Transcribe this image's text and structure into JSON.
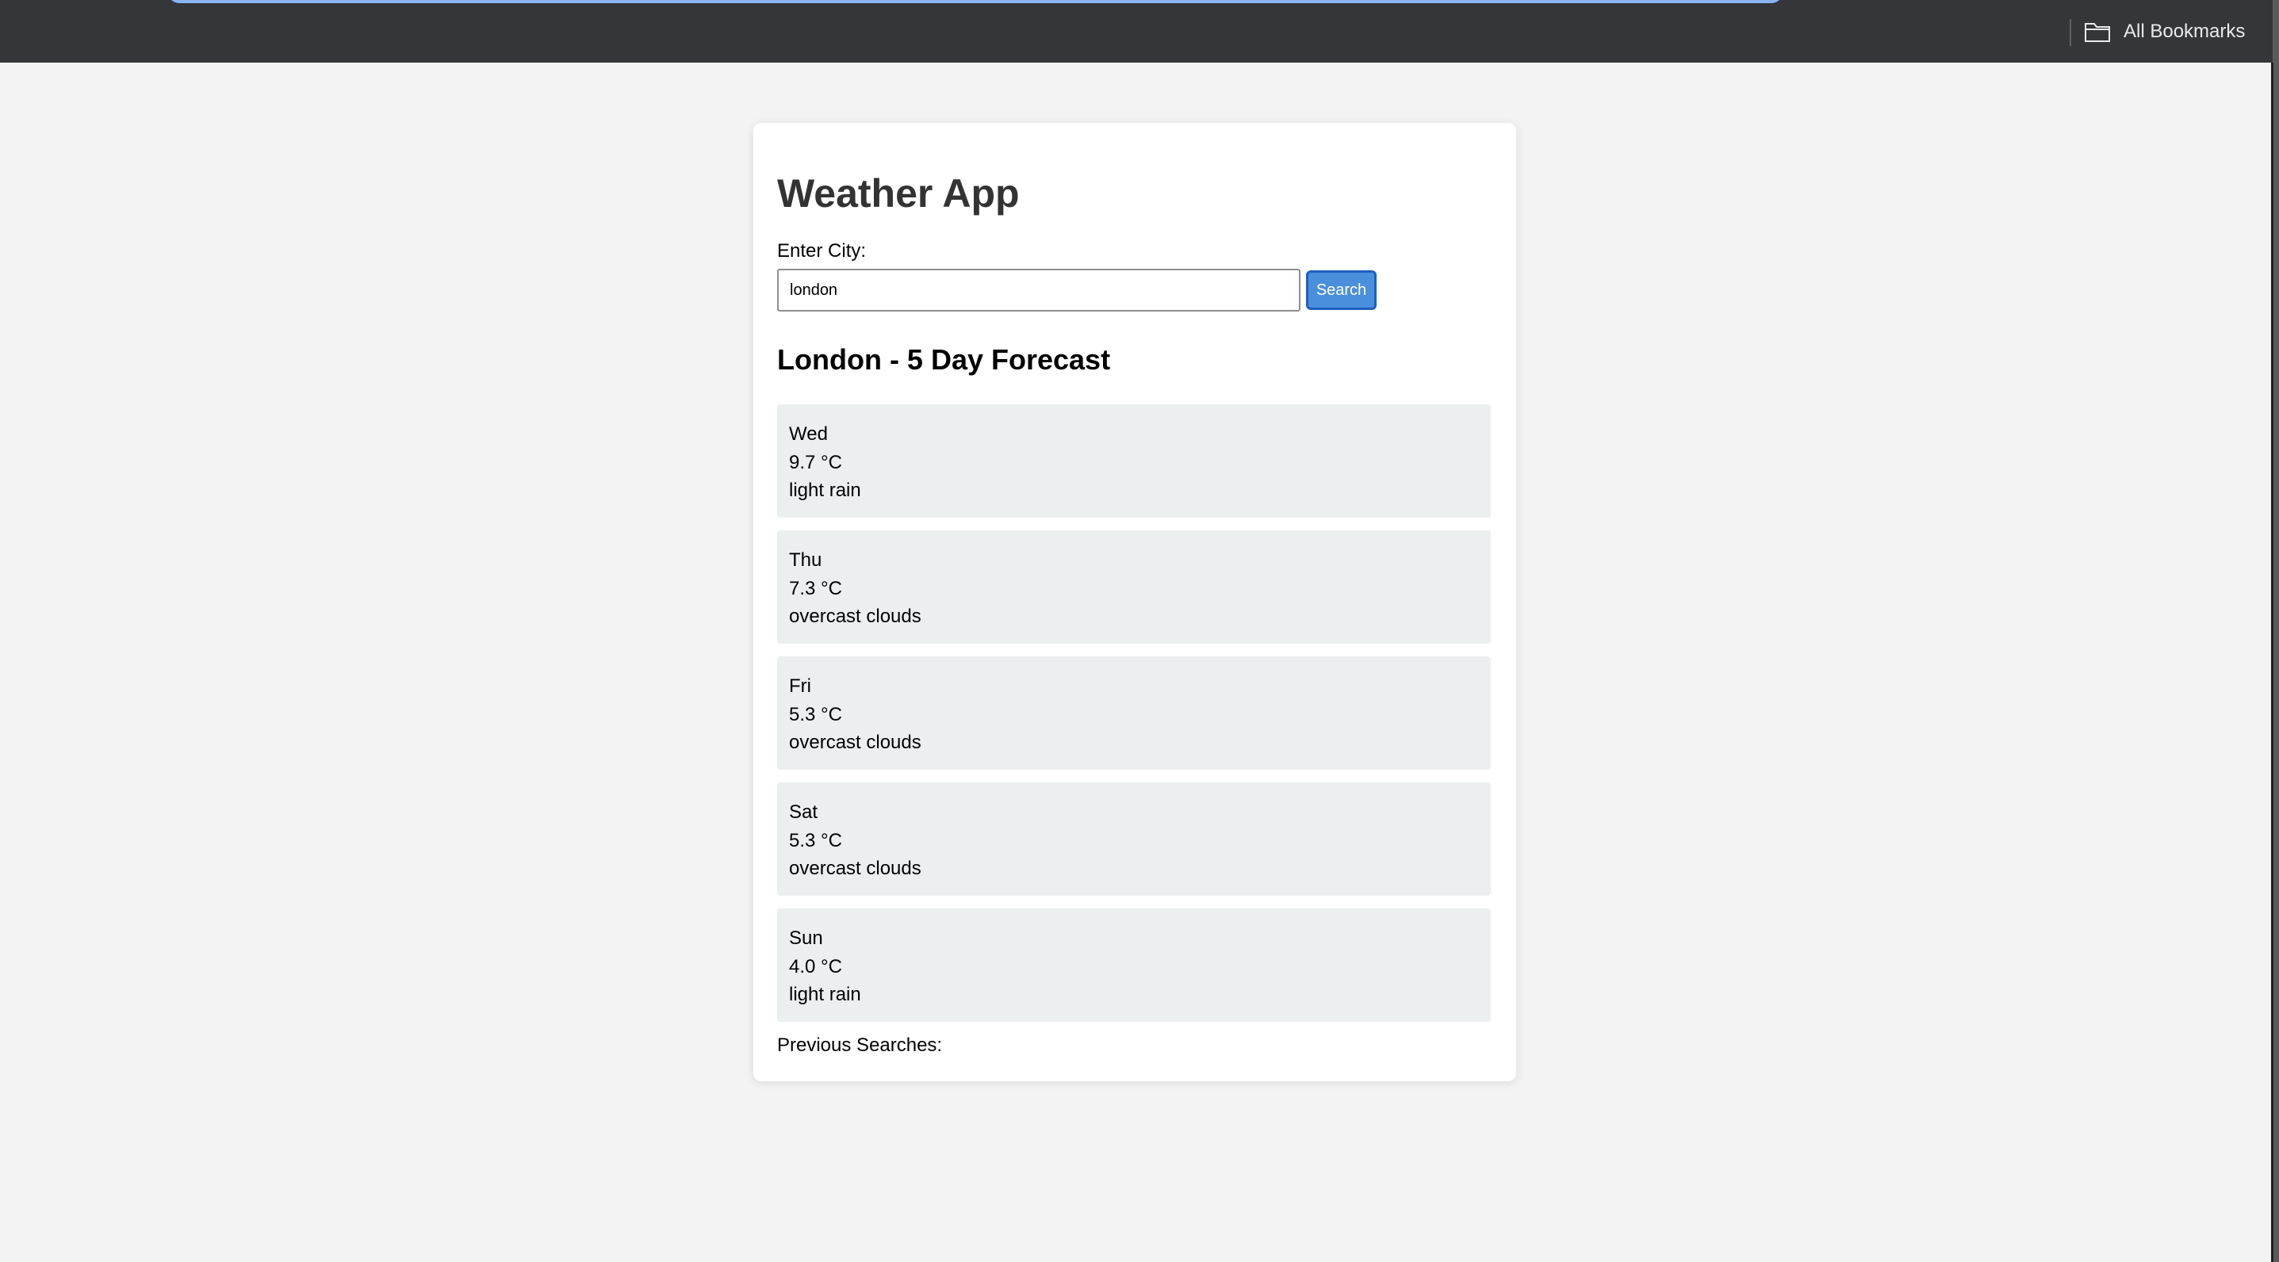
{
  "browser": {
    "bookmarks_label": "All Bookmarks"
  },
  "app": {
    "title": "Weather App",
    "city_label": "Enter City:",
    "city_value": "london",
    "search_button": "Search",
    "forecast_title": "London - 5 Day Forecast",
    "previous_searches_label": "Previous Searches:"
  },
  "forecast": [
    {
      "day": "Wed",
      "temp": "9.7 °C",
      "desc": "light rain"
    },
    {
      "day": "Thu",
      "temp": "7.3 °C",
      "desc": "overcast clouds"
    },
    {
      "day": "Fri",
      "temp": "5.3 °C",
      "desc": "overcast clouds"
    },
    {
      "day": "Sat",
      "temp": "5.3 °C",
      "desc": "overcast clouds"
    },
    {
      "day": "Sun",
      "temp": "4.0 °C",
      "desc": "light rain"
    }
  ],
  "icons": {
    "bookmarks": "folder-icon"
  },
  "colors": {
    "accent": "#4a8fdb",
    "card_background": "#eceff0",
    "browser_bar": "#34363a"
  }
}
